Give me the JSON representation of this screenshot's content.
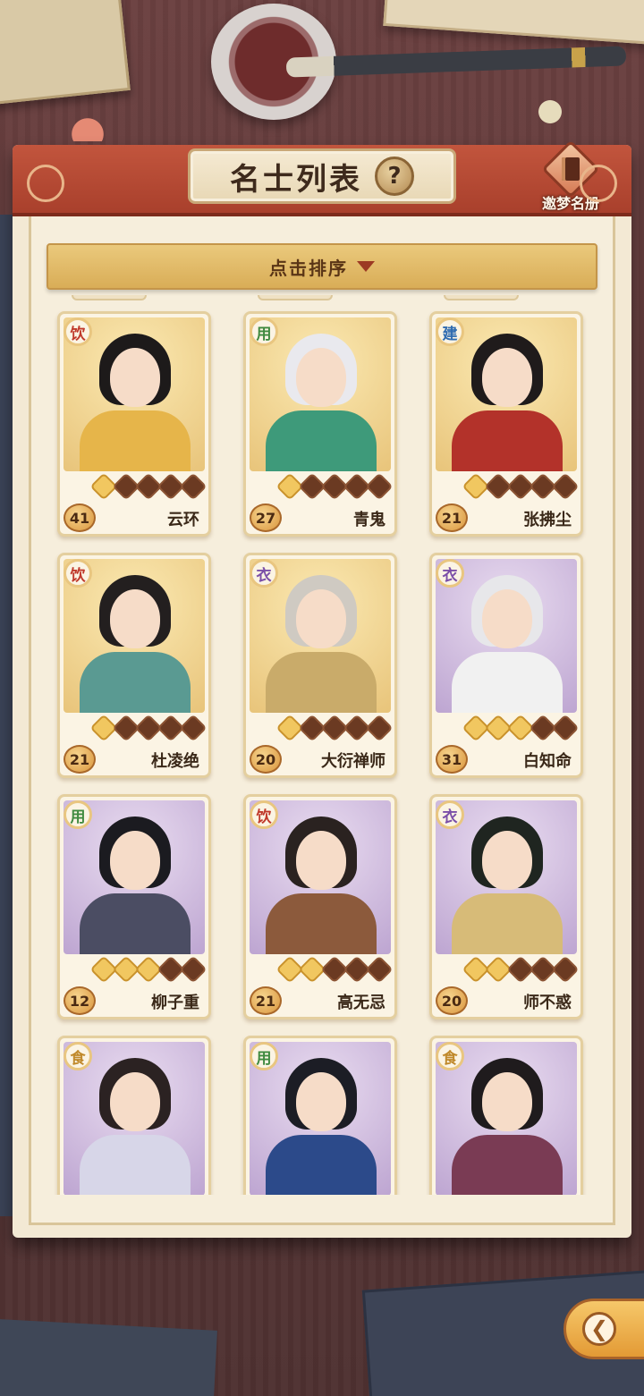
{
  "header": {
    "title": "名士列表",
    "help_symbol": "?",
    "register_label": "邀梦名册"
  },
  "sort": {
    "label": "点击排序"
  },
  "cards": [
    {
      "name": "云环",
      "level": "41",
      "category": "饮",
      "category_icon": "drink-badge-icon",
      "stars": 1,
      "bg": "gold"
    },
    {
      "name": "青鬼",
      "level": "27",
      "category": "用",
      "category_icon": "use-badge-icon",
      "stars": 1,
      "bg": "gold"
    },
    {
      "name": "张拂尘",
      "level": "21",
      "category": "建",
      "category_icon": "build-badge-icon",
      "stars": 1,
      "bg": "gold"
    },
    {
      "name": "杜凌绝",
      "level": "21",
      "category": "饮",
      "category_icon": "drink-badge-icon",
      "stars": 1,
      "bg": "gold"
    },
    {
      "name": "大衍禅师",
      "level": "20",
      "category": "衣",
      "category_icon": "cloth-badge-icon",
      "stars": 1,
      "bg": "gold"
    },
    {
      "name": "白知命",
      "level": "31",
      "category": "衣",
      "category_icon": "cloth-badge-icon",
      "stars": 3,
      "bg": "purple"
    },
    {
      "name": "柳子重",
      "level": "12",
      "category": "用",
      "category_icon": "use-badge-icon",
      "stars": 3,
      "bg": "purple"
    },
    {
      "name": "高无忌",
      "level": "21",
      "category": "饮",
      "category_icon": "drink-badge-icon",
      "stars": 2,
      "bg": "purple"
    },
    {
      "name": "师不惑",
      "level": "20",
      "category": "衣",
      "category_icon": "cloth-badge-icon",
      "stars": 2,
      "bg": "purple"
    },
    {
      "name": "",
      "level": "",
      "category": "食",
      "category_icon": "food-badge-icon",
      "stars": 0,
      "bg": "purple"
    },
    {
      "name": "",
      "level": "",
      "category": "用",
      "category_icon": "use-badge-icon",
      "stars": 0,
      "bg": "purple"
    },
    {
      "name": "",
      "level": "",
      "category": "食",
      "category_icon": "food-badge-icon",
      "stars": 0,
      "bg": "purple"
    }
  ],
  "back_button": {
    "icon": "back-arrow-icon"
  }
}
